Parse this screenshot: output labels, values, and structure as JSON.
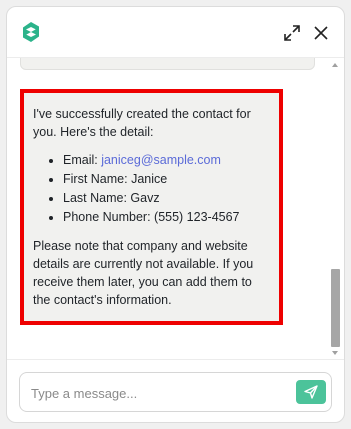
{
  "header": {
    "logo_icon": "brand-logo-icon",
    "expand_icon": "expand-icon",
    "close_icon": "close-icon",
    "brand_color": "#2bb38a"
  },
  "messages": [
    {
      "role": "assistant",
      "intro": "I've successfully created the contact for you. Here's the detail:",
      "details": [
        {
          "label": "Email: ",
          "value": "janiceg@sample.com",
          "is_link": true
        },
        {
          "label": "First Name: ",
          "value": "Janice",
          "is_link": false
        },
        {
          "label": "Last Name: ",
          "value": "Gavz",
          "is_link": false
        },
        {
          "label": "Phone Number: ",
          "value": "(555) 123-4567",
          "is_link": false
        }
      ],
      "note": "Please note that company and website details are currently not available. If you receive them later, you can add them to the contact's information."
    }
  ],
  "composer": {
    "placeholder": "Type a message...",
    "send_icon": "send-icon",
    "send_color": "#4cc39a"
  },
  "highlight_color": "#ee0000",
  "link_color": "#5b6bd8"
}
